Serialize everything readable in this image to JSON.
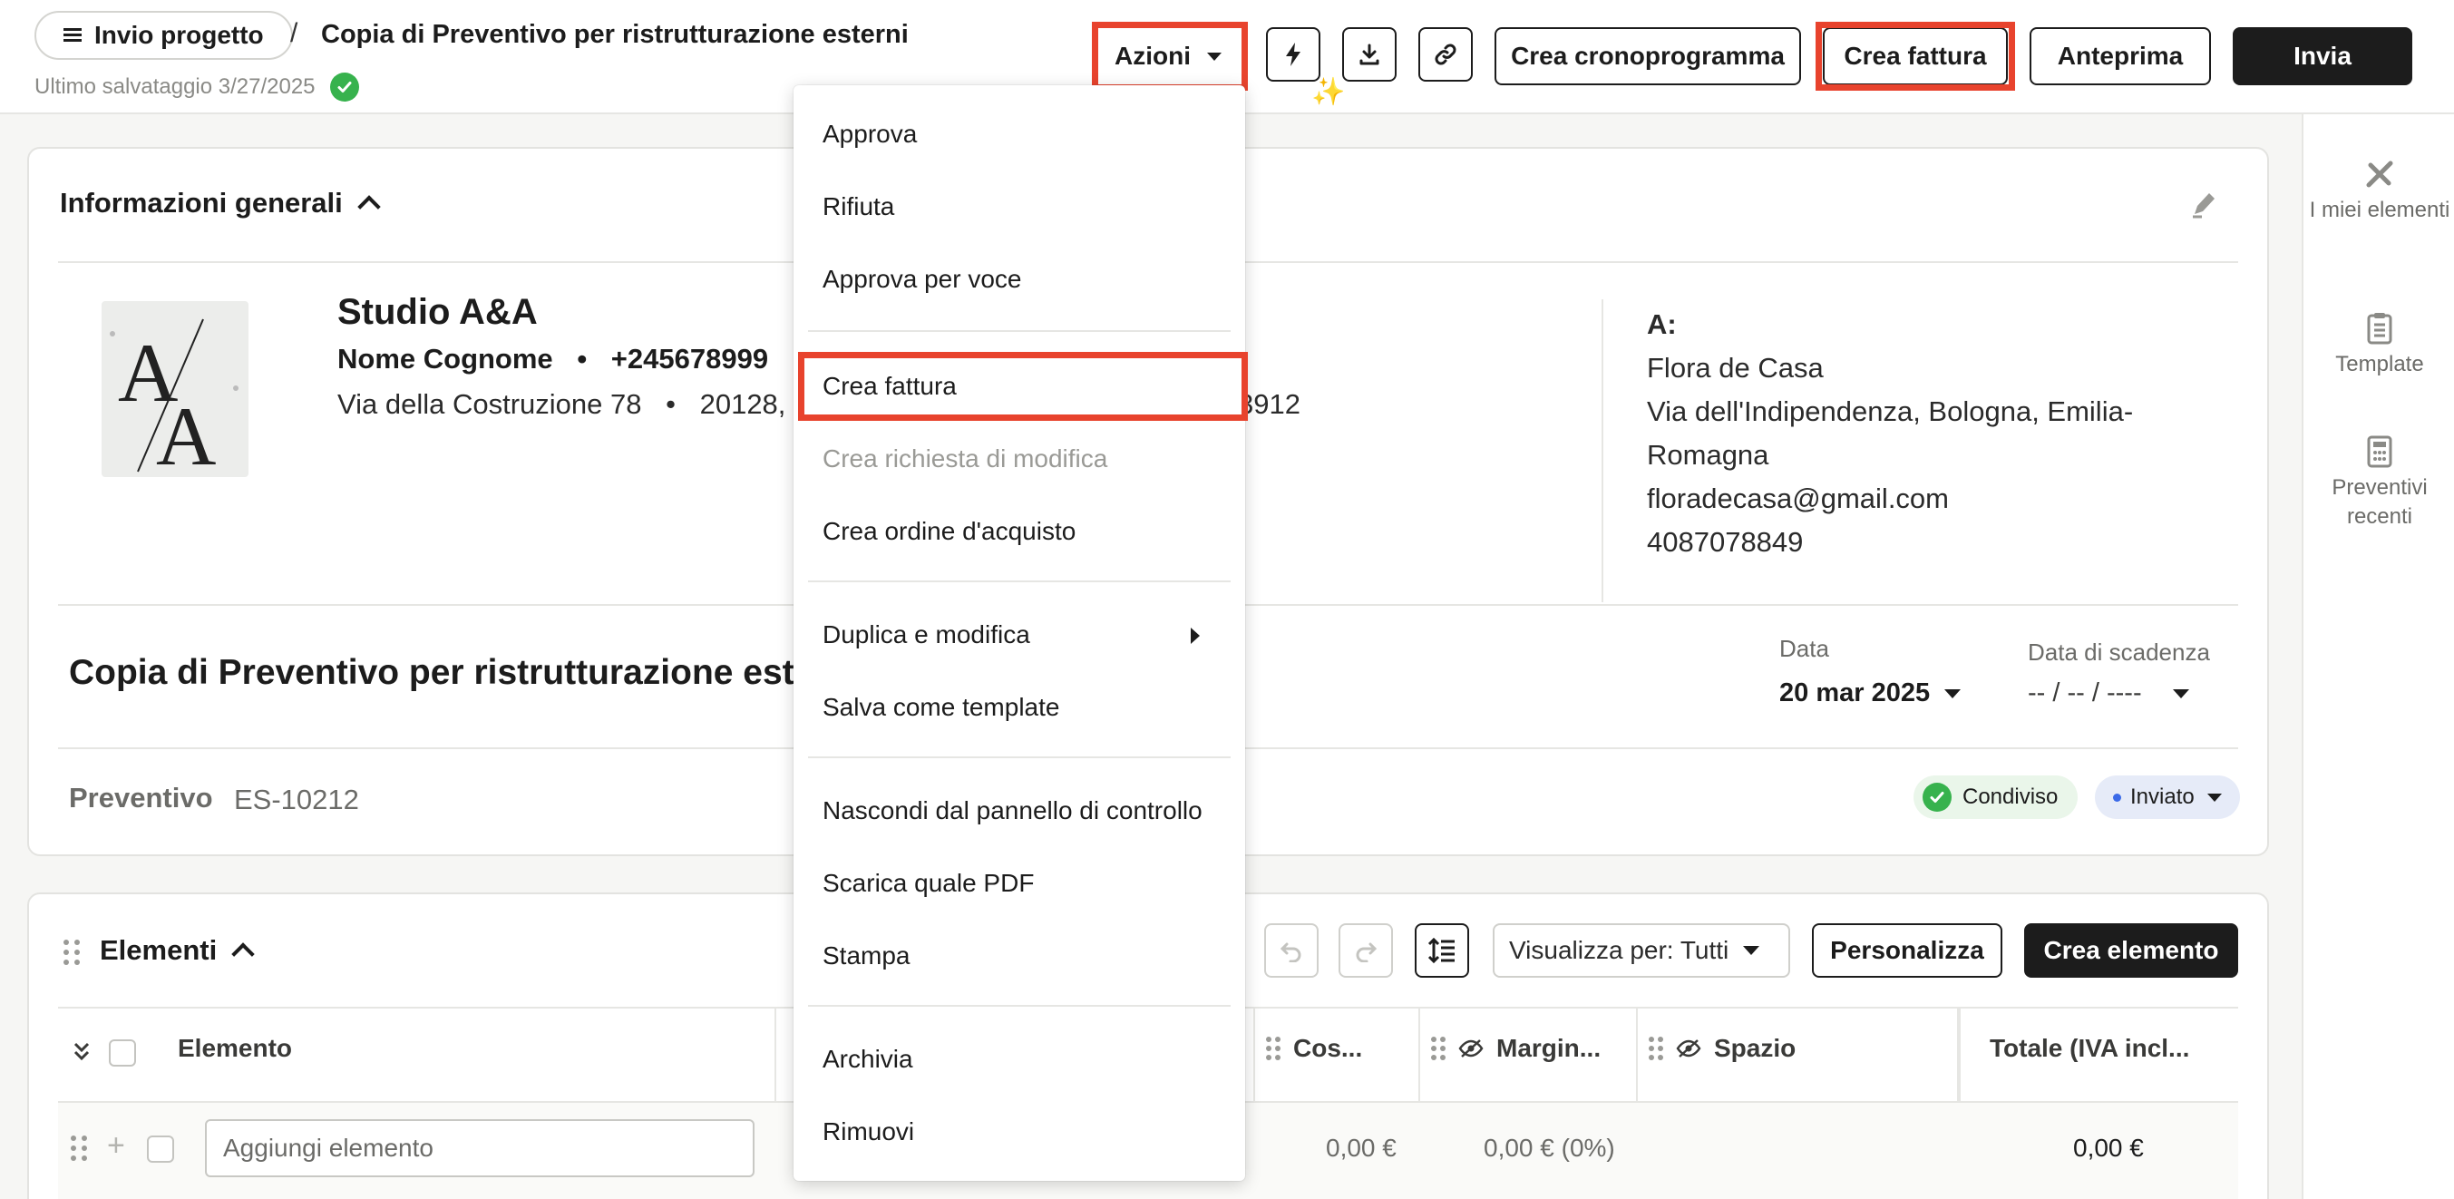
{
  "header": {
    "project_button": "Invio progetto",
    "separator": "/",
    "title": "Copia di Preventivo per ristrutturazione esterni",
    "last_saved": "Ultimo salvataggio 3/27/2025",
    "actions_label": "Azioni",
    "schedule_button": "Crea cronoprogramma",
    "invoice_button": "Crea fattura",
    "preview_button": "Anteprima",
    "send_button": "Invia"
  },
  "sidebar": {
    "items": [
      {
        "label": "I miei elementi",
        "icon": "tools-icon"
      },
      {
        "label": "Template",
        "icon": "clipboard-icon"
      },
      {
        "label": "Preventivi recenti",
        "icon": "calculator-icon"
      }
    ]
  },
  "general_info": {
    "title": "Informazioni generali",
    "company_name": "Studio A&A",
    "contact_name": "Nome Cognome",
    "contact_sep": "•",
    "contact_phone": "+245678999",
    "address_street": "Via della Costruzione 78",
    "address_sep": "•",
    "address_rest": "20128,",
    "address_tail": "3912",
    "to_label": "A:",
    "to_name": "Flora de Casa",
    "to_address": "Via dell'Indipendenza, Bologna, Emilia-Romagna",
    "to_email": "floradecasa@gmail.com",
    "to_phone": "4087078849",
    "doc_title": "Copia di Preventivo per ristrutturazione este",
    "date_label": "Data",
    "date_value": "20 mar 2025",
    "due_label": "Data di scadenza",
    "due_value": "-- / -- / ----",
    "doc_type": "Preventivo",
    "doc_number": "ES-10212",
    "shared_badge": "Condiviso",
    "status_badge": "Inviato"
  },
  "elements": {
    "title": "Elementi",
    "view_by": "Visualizza per: Tutti",
    "customize_button": "Personalizza",
    "create_button": "Crea elemento",
    "columns": [
      "Elemento",
      "Cos...",
      "Margin...",
      "Spazio",
      "Totale (IVA incl..."
    ],
    "add_placeholder": "Aggiungi elemento",
    "row": {
      "cost": "0,00 €",
      "margin": "0,00 € (0%)",
      "total": "0,00 €"
    }
  },
  "actions_menu": {
    "groups": [
      [
        "Approva",
        "Rifiuta",
        "Approva per voce"
      ],
      [
        "Crea fattura",
        "Crea richiesta di modifica",
        "Crea ordine d'acquisto"
      ],
      [
        "Duplica e modifica",
        "Salva come template"
      ],
      [
        "Nascondi dal pannello di controllo",
        "Scarica quale PDF",
        "Stampa"
      ],
      [
        "Archivia",
        "Rimuovi"
      ]
    ],
    "disabled_item": "Crea richiesta di modifica",
    "highlighted_item": "Crea fattura"
  },
  "colors": {
    "highlight": "#e8432d",
    "primary_dark": "#1c1c1c",
    "success": "#37b24d",
    "sent_badge_bg": "#e6ebf8"
  }
}
